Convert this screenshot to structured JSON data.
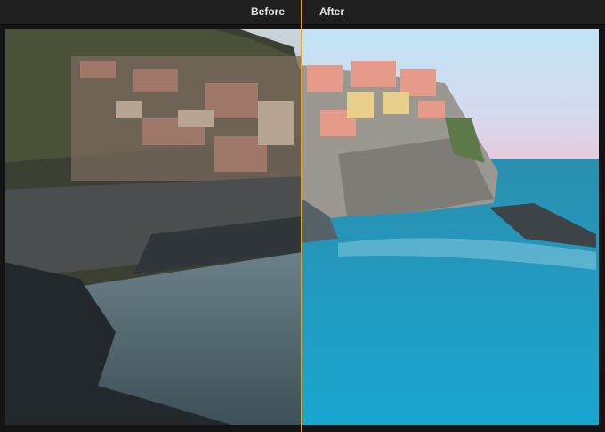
{
  "header": {
    "before_label": "Before",
    "after_label": "After"
  },
  "colors": {
    "divider": "#e8a21c",
    "background": "#141414"
  },
  "comparison": {
    "split_position_percent": 50
  }
}
